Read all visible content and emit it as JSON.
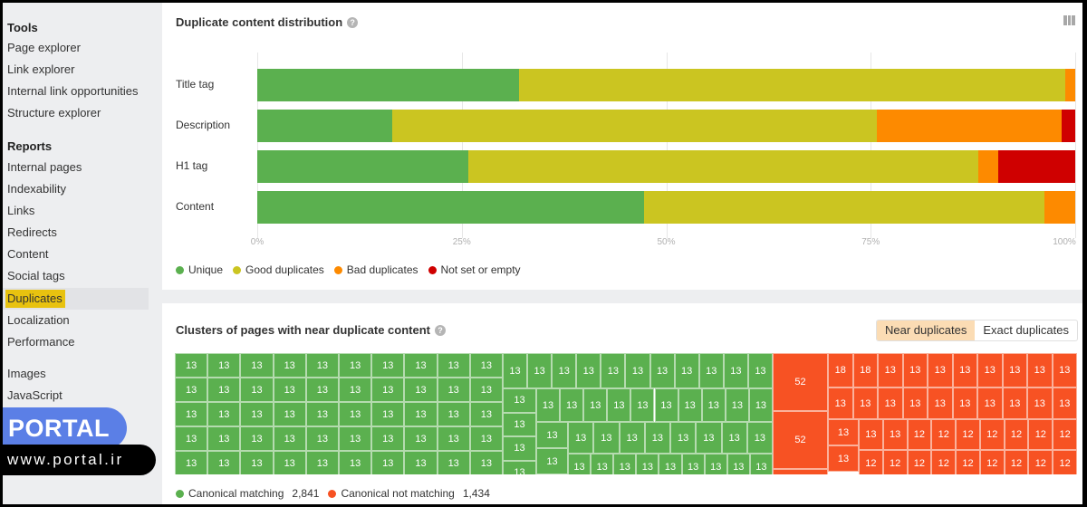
{
  "sidebar": {
    "sections": [
      {
        "title": "Tools",
        "items": [
          "Page explorer",
          "Link explorer",
          "Internal link opportunities",
          "Structure explorer"
        ]
      },
      {
        "title": "Reports",
        "items": [
          "Internal pages",
          "Indexability",
          "Links",
          "Redirects",
          "Content",
          "Social tags",
          "Duplicates",
          "Localization",
          "Performance"
        ]
      },
      {
        "title": "",
        "items": [
          "Images",
          "JavaScript"
        ]
      }
    ],
    "active_item": "Duplicates"
  },
  "watermark": {
    "brand": "PORTAL",
    "url": "www.portal.ir"
  },
  "distribution_panel": {
    "title": "Duplicate content distribution",
    "help_icon": "question-circle-icon",
    "columns_icon": "columns-icon"
  },
  "clusters_panel": {
    "title": "Clusters of pages with near duplicate content",
    "help_icon": "question-circle-icon",
    "toggle": {
      "options": [
        "Near duplicates",
        "Exact duplicates"
      ],
      "selected": "Near duplicates"
    },
    "legend": [
      {
        "label": "Canonical matching",
        "count": "2,841",
        "color": "#5bb04f"
      },
      {
        "label": "Canonical not matching",
        "count": "1,434",
        "color": "#f75223"
      }
    ],
    "green_clusters": {
      "left_grid": {
        "rows": 5,
        "cols": 10,
        "value": "13"
      },
      "col_a": [
        "13",
        "13",
        "13",
        "13",
        "13"
      ],
      "row1": [
        "13",
        "13",
        "13",
        "13",
        "13",
        "13",
        "13",
        "13",
        "13",
        "13",
        "13"
      ],
      "row2": [
        "13",
        "13",
        "13",
        "13",
        "13",
        "13",
        "13",
        "13",
        "13",
        "13"
      ],
      "col_b": [
        "13",
        "13"
      ],
      "row3": [
        "13",
        "13",
        "13",
        "13",
        "13",
        "13",
        "13",
        "13"
      ],
      "row4": [
        "13",
        "13",
        "13",
        "13",
        "13",
        "13",
        "13",
        "13",
        "13"
      ]
    },
    "red_clusters": {
      "big": [
        "52",
        "52"
      ],
      "row1": [
        "18",
        "18",
        "13",
        "13",
        "13",
        "13",
        "13",
        "13",
        "13",
        "13"
      ],
      "row2": [
        "13",
        "13",
        "13",
        "13",
        "13",
        "13",
        "13",
        "13",
        "13",
        "13"
      ],
      "col_a": [
        "13",
        "13"
      ],
      "row3": [
        "13",
        "13",
        "12",
        "12",
        "12",
        "12",
        "12",
        "12",
        "12"
      ],
      "row4": [
        "12",
        "12",
        "12",
        "12",
        "12",
        "12",
        "12",
        "12",
        "12"
      ]
    }
  },
  "chart_data": {
    "type": "bar",
    "orientation": "horizontal-stacked-100",
    "title": "Duplicate content distribution",
    "categories": [
      "Title tag",
      "Description",
      "H1 tag",
      "Content"
    ],
    "series": [
      {
        "name": "Unique",
        "color": "#5bb04f",
        "values": [
          32.0,
          16.5,
          25.8,
          47.3
        ]
      },
      {
        "name": "Good duplicates",
        "color": "#cbc521",
        "values": [
          66.8,
          59.2,
          62.3,
          48.9
        ]
      },
      {
        "name": "Bad duplicates",
        "color": "#fd8a00",
        "values": [
          1.2,
          22.6,
          2.5,
          3.8
        ]
      },
      {
        "name": "Not set or empty",
        "color": "#cf0000",
        "values": [
          0.0,
          1.7,
          9.4,
          0.0
        ]
      }
    ],
    "xticks": [
      "0%",
      "25%",
      "50%",
      "75%",
      "100%"
    ],
    "xlim": [
      0,
      100
    ],
    "grid": true,
    "legend_position": "bottom-left"
  }
}
